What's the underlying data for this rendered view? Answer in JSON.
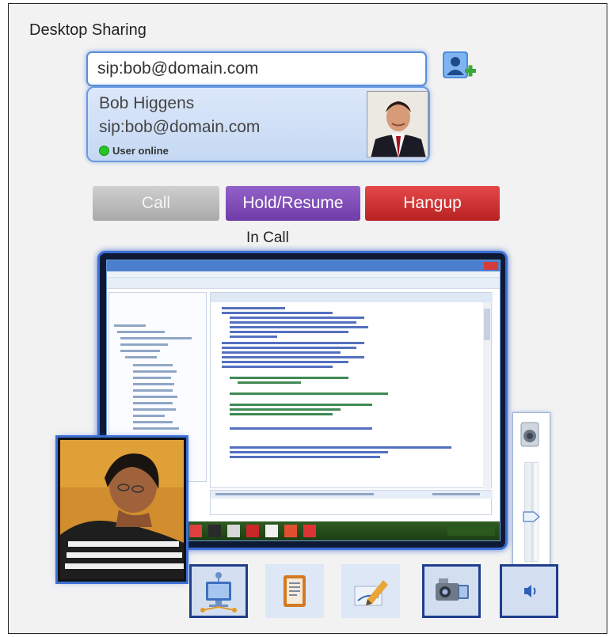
{
  "app": {
    "title": "Desktop Sharing"
  },
  "search": {
    "value": "sip:bob@domain.com",
    "placeholder": ""
  },
  "contact": {
    "name": "Bob Higgens",
    "sip": "sip:bob@domain.com",
    "status": "User online"
  },
  "controls": {
    "call_label": "Call",
    "hold_label": "Hold/Resume",
    "hangup_label": "Hangup"
  },
  "call_status": "In Call",
  "toolbar": {
    "icons": [
      "share-desktop-icon",
      "notes-icon",
      "whiteboard-icon",
      "video-camera-icon",
      "volume-icon"
    ]
  },
  "volume": {
    "level": 0.45
  },
  "colors": {
    "accent_blue": "#3c6fd4",
    "call_gray": "#bcbcbc",
    "hold_purple": "#7f4cb8",
    "hangup_red": "#cc3333",
    "online_green": "#26c526"
  }
}
